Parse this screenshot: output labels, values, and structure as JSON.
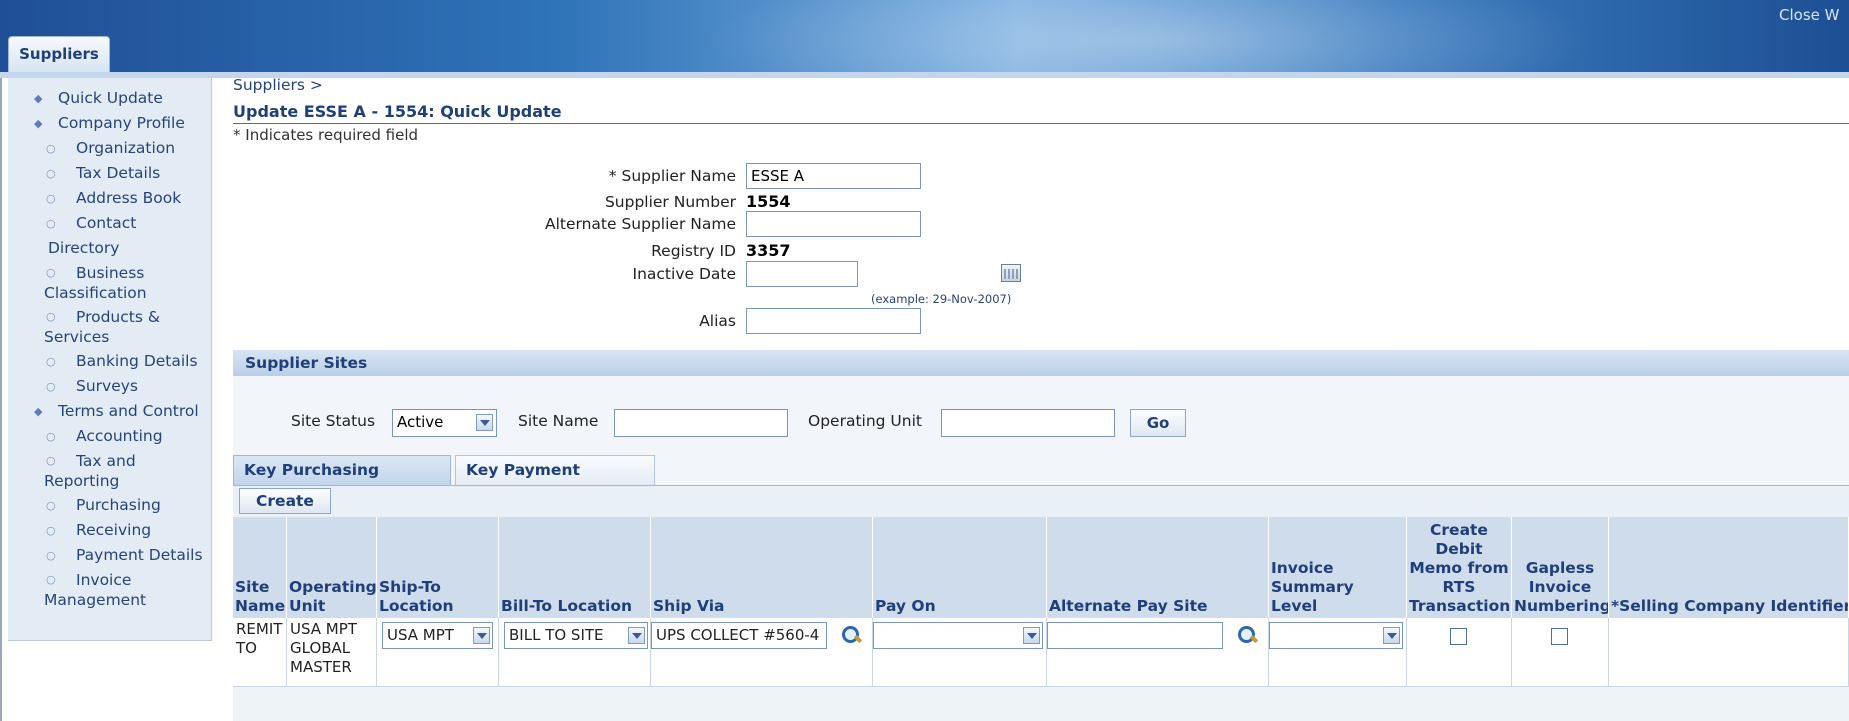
{
  "header": {
    "close_link": "Close W",
    "tab_label": "Suppliers"
  },
  "sidebar": {
    "items": [
      {
        "label": "Quick Update",
        "level": 1
      },
      {
        "label": "Company Profile",
        "level": 1
      },
      {
        "label": "Organization",
        "level": 2
      },
      {
        "label": "Tax Details",
        "level": 2
      },
      {
        "label": "Address Book",
        "level": 2
      },
      {
        "label": "Contact Directory",
        "level": 2
      },
      {
        "label": "Business Classification",
        "level": 2
      },
      {
        "label": "Products & Services",
        "level": 2
      },
      {
        "label": "Banking Details",
        "level": 2
      },
      {
        "label": "Surveys",
        "level": 2
      },
      {
        "label": "Terms and Control",
        "level": 1
      },
      {
        "label": "Accounting",
        "level": 2
      },
      {
        "label": "Tax and Reporting",
        "level": 2
      },
      {
        "label": "Purchasing",
        "level": 2
      },
      {
        "label": "Receiving",
        "level": 2
      },
      {
        "label": "Payment Details",
        "level": 2
      },
      {
        "label": "Invoice Management",
        "level": 2
      }
    ]
  },
  "main": {
    "breadcrumb": "Suppliers >",
    "title": "Update ESSE A - 1554: Quick Update",
    "required_note": "* Indicates required field",
    "form": {
      "supplier_name_label": "* Supplier Name",
      "supplier_name_value": "ESSE A",
      "supplier_number_label": "Supplier Number",
      "supplier_number_value": "1554",
      "alternate_name_label": "Alternate Supplier Name",
      "alternate_name_value": "",
      "registry_id_label": "Registry ID",
      "registry_id_value": "3357",
      "inactive_date_label": "Inactive Date",
      "inactive_date_value": "",
      "date_example": "(example: 29-Nov-2007)",
      "alias_label": "Alias",
      "alias_value": ""
    }
  },
  "supplier_sites": {
    "section_title": "Supplier Sites",
    "search": {
      "site_status_label": "Site Status",
      "site_status_value": "Active",
      "site_name_label": "Site Name",
      "site_name_value": "",
      "operating_unit_label": "Operating Unit",
      "operating_unit_value": "",
      "go_label": "Go"
    },
    "tabs": [
      {
        "label": "Key Purchasing Setups",
        "active": true
      },
      {
        "label": "Key Payment Setups",
        "active": false
      }
    ],
    "create_label": "Create",
    "columns": [
      "Site Name",
      "Operating Unit",
      "Ship-To Location",
      "Bill-To Location",
      "Ship Via",
      "Pay On",
      "Alternate Pay Site",
      "Invoice Summary Level",
      "Create Debit Memo from RTS Transaction",
      "Gapless Invoice Numbering",
      "*Selling Company Identifier"
    ],
    "row": {
      "site_name": "REMIT TO",
      "operating_unit": "USA MPT GLOBAL MASTER",
      "ship_to": "USA MPT",
      "bill_to": "BILL TO SITE",
      "ship_via": "UPS COLLECT #560-4",
      "pay_on": "",
      "alternate_pay_site": "",
      "invoice_summary_level": "",
      "create_debit_memo": false,
      "gapless_numbering": false,
      "selling_company_identifier": ""
    }
  }
}
